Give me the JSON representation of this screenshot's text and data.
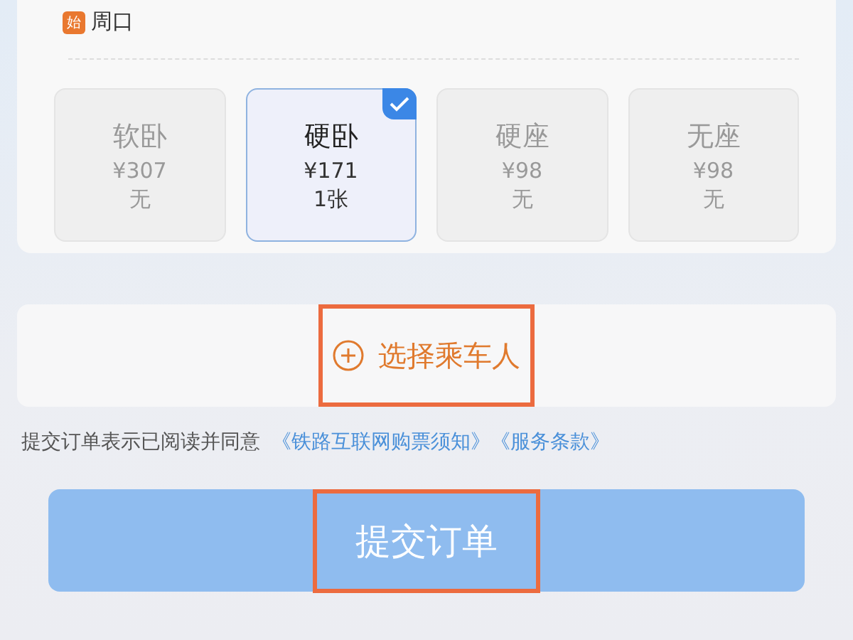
{
  "departure": {
    "badge": "始",
    "station": "周口"
  },
  "seats": [
    {
      "name": "软卧",
      "price": "¥307",
      "availability": "无",
      "selected": false,
      "available": false
    },
    {
      "name": "硬卧",
      "price": "¥171",
      "availability": "1张",
      "selected": true,
      "available": true
    },
    {
      "name": "硬座",
      "price": "¥98",
      "availability": "无",
      "selected": false,
      "available": false
    },
    {
      "name": "无座",
      "price": "¥98",
      "availability": "无",
      "selected": false,
      "available": false
    }
  ],
  "passenger_button": {
    "label": "选择乘车人",
    "highlighted": true
  },
  "agreement": {
    "text": "提交订单表示已阅读并同意",
    "links": [
      "《铁路互联网购票须知》",
      "《服务条款》"
    ]
  },
  "submit_button": {
    "label": "提交订单",
    "highlighted": true
  }
}
